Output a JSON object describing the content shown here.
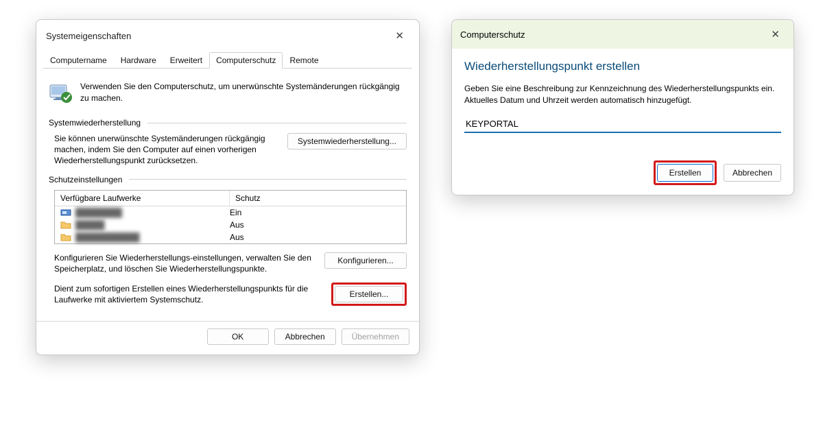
{
  "window1": {
    "title": "Systemeigenschaften",
    "tabs": {
      "computername": "Computername",
      "hardware": "Hardware",
      "erweitert": "Erweitert",
      "computerschutz": "Computerschutz",
      "remote": "Remote"
    },
    "intro": "Verwenden Sie den Computerschutz, um unerwünschte Systemänderungen rückgängig zu machen.",
    "sec1": {
      "title": "Systemwiederherstellung",
      "text": "Sie können unerwünschte Systemänderungen rückgängig machen, indem Sie den Computer auf einen vorherigen Wiederherstellungspunkt zurücksetzen.",
      "button": "Systemwiederherstellung..."
    },
    "sec2": {
      "title": "Schutzeinstellungen",
      "col1": "Verfügbare Laufwerke",
      "col2": "Schutz",
      "rows": [
        {
          "name": "████████",
          "status": "Ein",
          "type": "disk"
        },
        {
          "name": "█████",
          "status": "Aus",
          "type": "folder"
        },
        {
          "name": "███████████",
          "status": "Aus",
          "type": "folder"
        }
      ],
      "config_text": "Konfigurieren Sie Wiederherstellungs-einstellungen, verwalten Sie den Speicherplatz, und löschen Sie Wiederherstellungspunkte.",
      "config_button": "Konfigurieren...",
      "create_text": "Dient zum sofortigen Erstellen eines Wiederherstellungspunkts für die Laufwerke mit aktiviertem Systemschutz.",
      "create_button": "Erstellen..."
    },
    "footer": {
      "ok": "OK",
      "cancel": "Abbrechen",
      "apply": "Übernehmen"
    }
  },
  "window2": {
    "header": "Computerschutz",
    "title": "Wiederherstellungspunkt erstellen",
    "desc": "Geben Sie eine Beschreibung zur Kennzeichnung des Wiederherstellungspunkts ein. Aktuelles Datum und Uhrzeit werden automatisch hinzugefügt.",
    "input_value": "KEYPORTAL",
    "create": "Erstellen",
    "cancel": "Abbrechen"
  }
}
